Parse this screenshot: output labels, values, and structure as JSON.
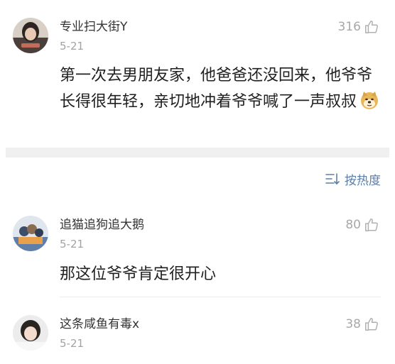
{
  "main_comment": {
    "username": "专业扫大街Y",
    "date": "5-21",
    "likes": "316",
    "text": "第一次去男朋友家，他爸爸还没回来，他爷爷长得很年轻，亲切地冲着爷爷喊了一声叔叔",
    "emoji": "doge-emoji"
  },
  "sort": {
    "label": "按热度",
    "icon": "sort-icon"
  },
  "replies": [
    {
      "username": "追猫追狗追大鹅",
      "date": "5-21",
      "likes": "80",
      "text": "那这位爷爷肯定很开心"
    },
    {
      "username": "这条咸鱼有毒x",
      "date": "5-21",
      "likes": "38"
    }
  ],
  "colors": {
    "accent": "#5b7ea8",
    "muted": "#a3a3a3",
    "separator": "#f0f0f0"
  }
}
